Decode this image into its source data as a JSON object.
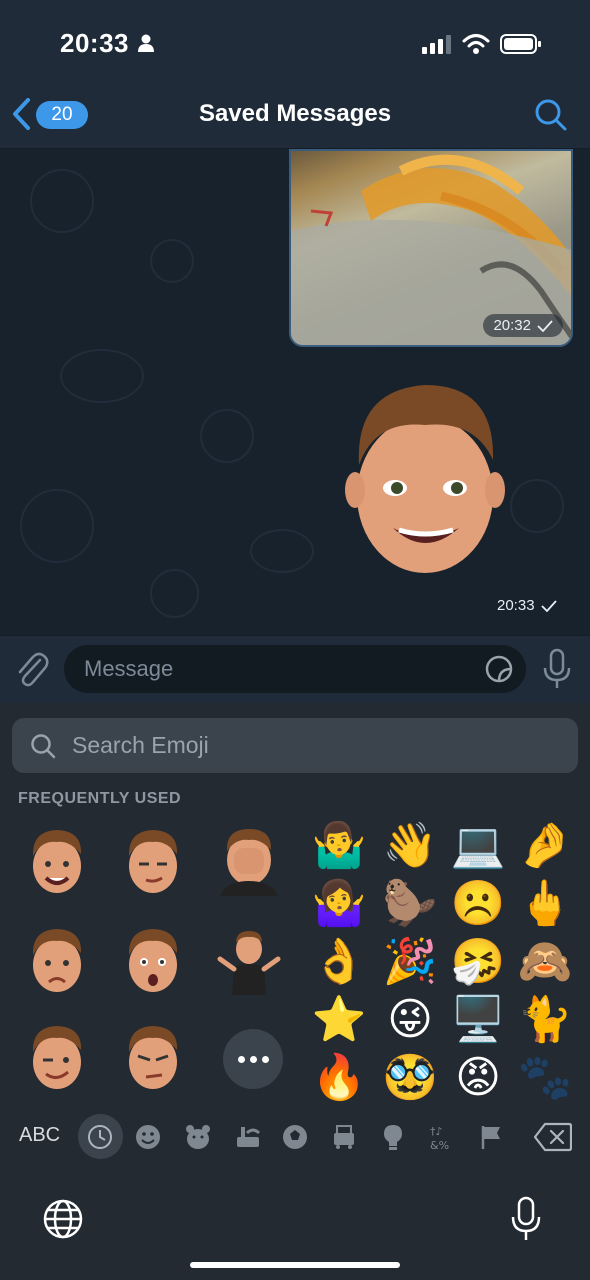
{
  "status_bar": {
    "time": "20:33"
  },
  "nav": {
    "back_count": "20",
    "title": "Saved Messages"
  },
  "messages": [
    {
      "type": "photo",
      "time": "20:32"
    },
    {
      "type": "sticker",
      "time": "20:33"
    }
  ],
  "composer": {
    "placeholder": "Message"
  },
  "emoji_panel": {
    "search_placeholder": "Search Emoji",
    "section_label": "FREQUENTLY USED",
    "emojis": [
      "🤷‍♂️",
      "👋",
      "💻",
      "🤌",
      "🤷‍♀️",
      "🦫",
      "☹️",
      "🖕",
      "👌",
      "🎉",
      "🤧",
      "🙈",
      "⭐",
      "😜",
      "🖥️",
      "🐈",
      "🔥",
      "🥸",
      "😡",
      "🐾"
    ],
    "categories": [
      "recent",
      "smileys",
      "animals",
      "food",
      "activity",
      "travel",
      "objects",
      "symbols",
      "flags"
    ],
    "abc_label": "ABC"
  },
  "colors": {
    "accent": "#3d98ea",
    "background": "#1c2733",
    "keyboard": "#232a31"
  }
}
